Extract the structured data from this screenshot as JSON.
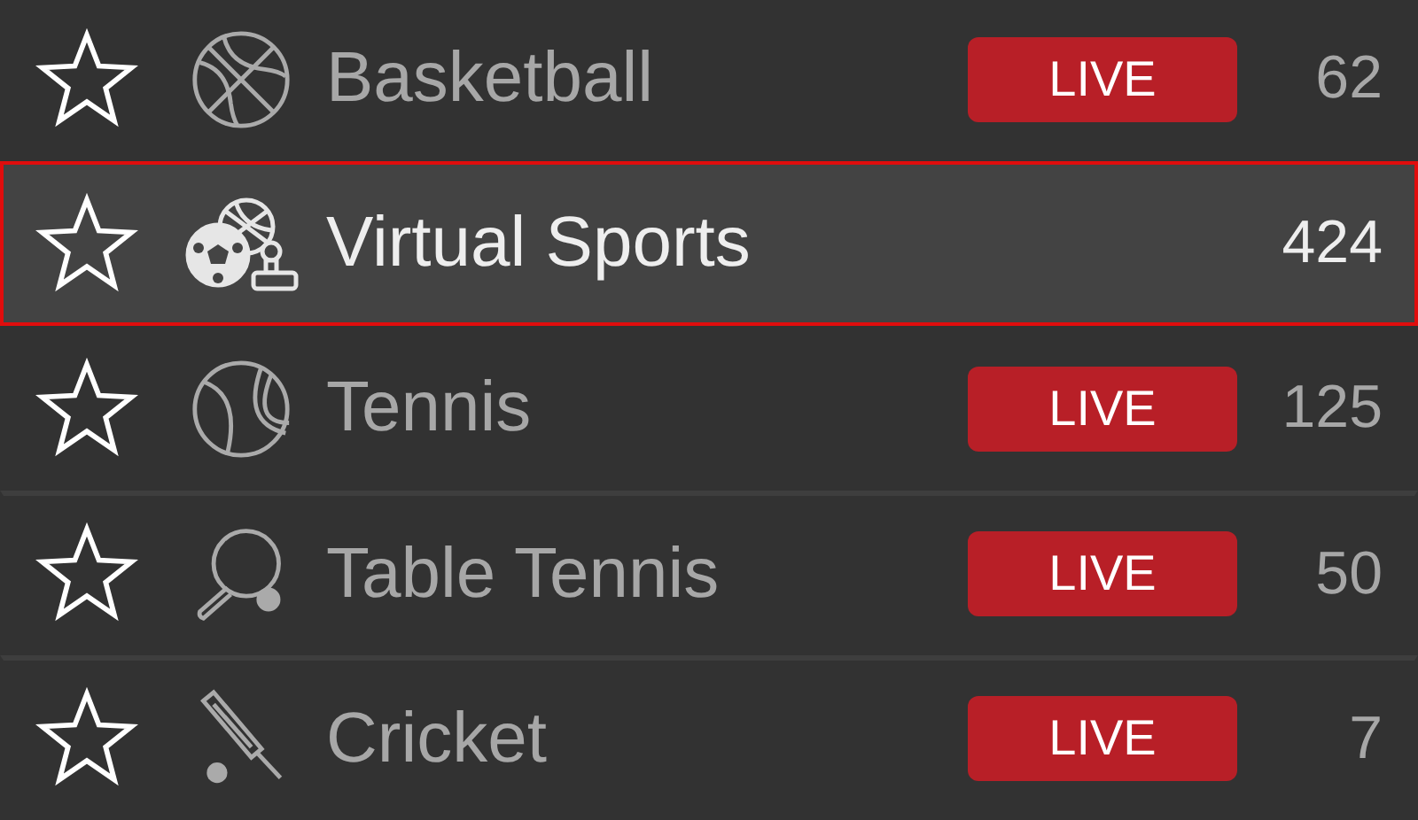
{
  "sports": [
    {
      "kind": "basketball",
      "name": "Basketball",
      "live_badge": "LIVE",
      "count": "62",
      "selected": false
    },
    {
      "kind": "virtual",
      "name": "Virtual Sports",
      "count": "424",
      "selected": true
    },
    {
      "kind": "tennis",
      "name": "Tennis",
      "live_badge": "LIVE",
      "count": "125",
      "selected": false
    },
    {
      "kind": "table-tennis",
      "name": "Table Tennis",
      "live_badge": "LIVE",
      "count": "50",
      "selected": false
    },
    {
      "kind": "cricket",
      "name": "Cricket",
      "live_badge": "LIVE",
      "count": "7",
      "selected": false
    }
  ]
}
